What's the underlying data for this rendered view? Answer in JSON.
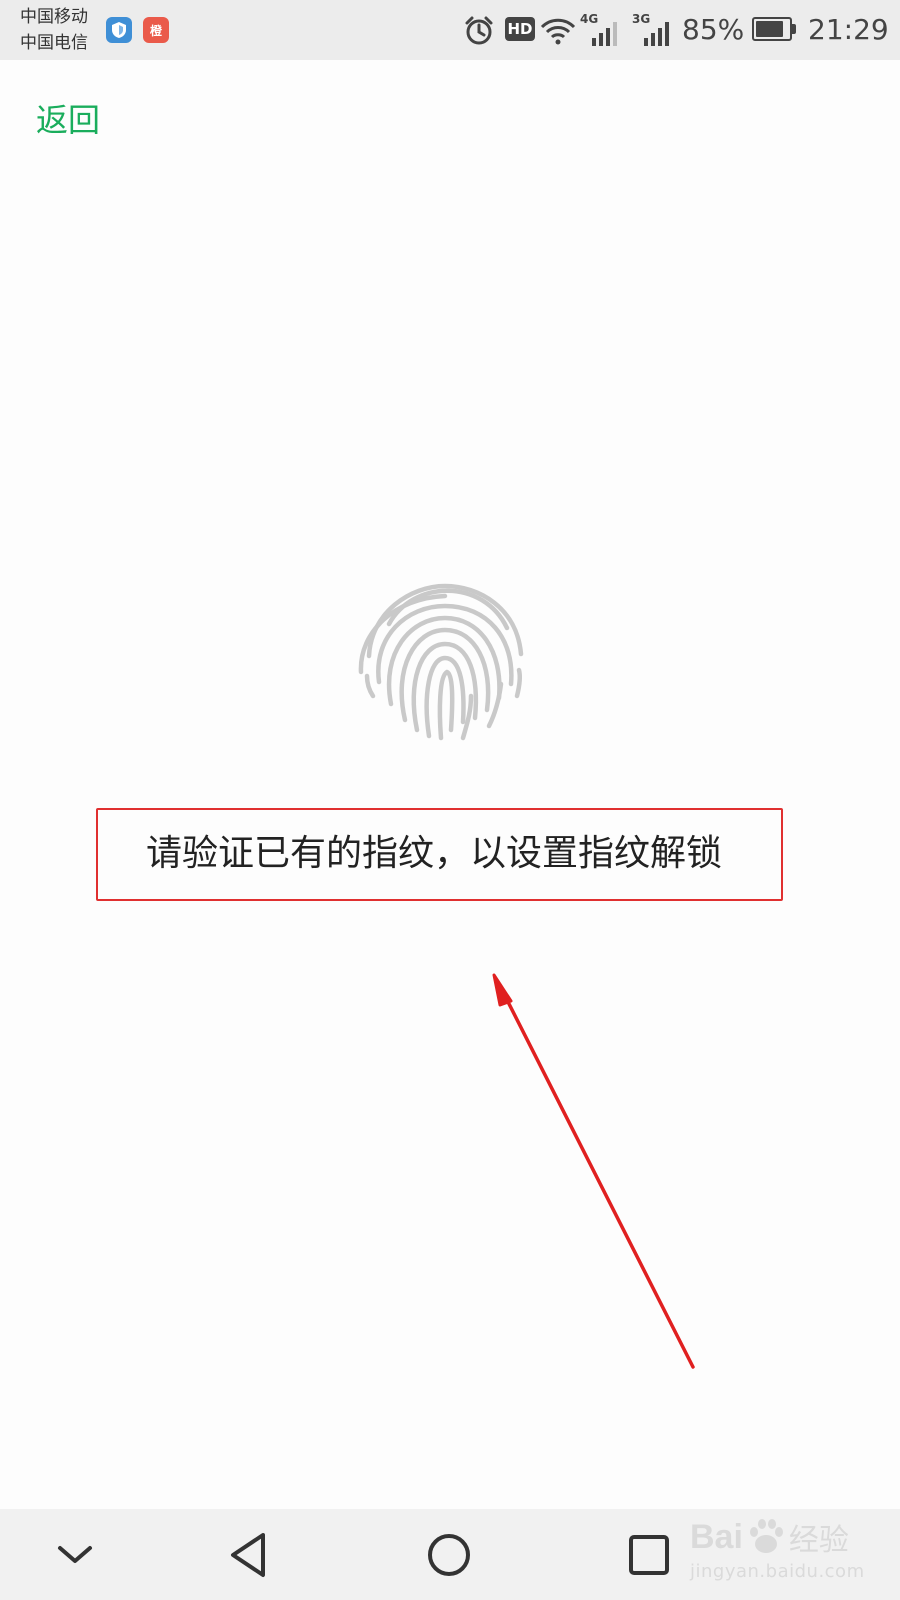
{
  "status_bar": {
    "carrier_1": "中国移动",
    "carrier_2": "中国电信",
    "app_badge": "橙",
    "hd_label": "HD",
    "net_1": "4G",
    "net_2": "3G",
    "battery_percent": "85%",
    "battery_level": 0.85,
    "time": "21:29",
    "icons": [
      "shield-icon",
      "app-badge-icon",
      "alarm-icon",
      "hd-icon",
      "wifi-icon",
      "signal-4g-icon",
      "signal-3g-icon",
      "battery-icon"
    ]
  },
  "header": {
    "back_label": "返回",
    "accent_color": "#1aad5c"
  },
  "main": {
    "fingerprint_icon": "fingerprint-icon",
    "prompt": "请验证已有的指纹，以设置指纹解锁",
    "highlight_color": "#e03030"
  },
  "nav_bar": {
    "buttons": [
      "collapse-icon",
      "back-triangle-icon",
      "home-circle-icon",
      "recents-square-icon"
    ]
  },
  "watermark": {
    "brand": "Bai",
    "brand_suffix": "经验",
    "url": "jingyan.baidu.com"
  }
}
